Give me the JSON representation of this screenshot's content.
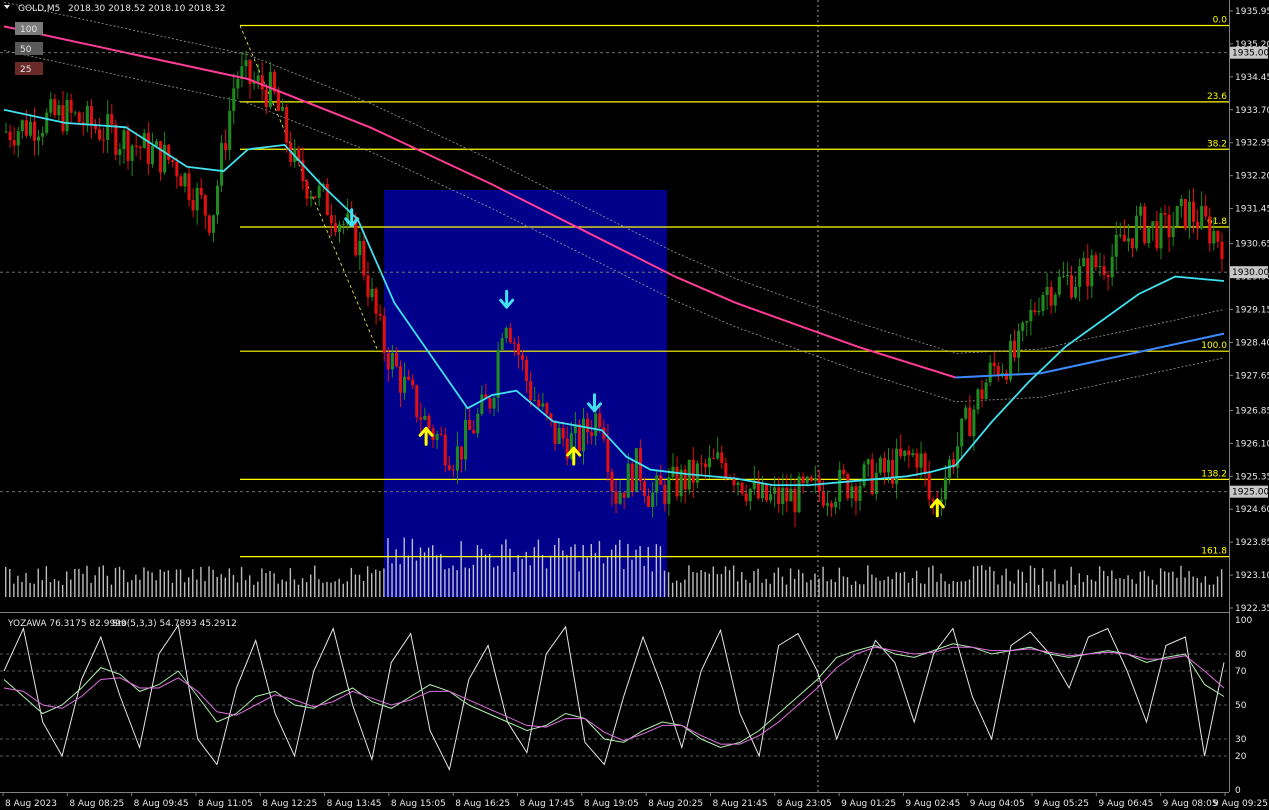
{
  "header": {
    "symbol": "GOLD,M5",
    "ohlc": "2018.30 2018.52 2018.10 2018.32",
    "collapse_icon": "triangle-down-icon"
  },
  "badges": [
    "100",
    "50",
    "25"
  ],
  "indicator": {
    "title": "YOZAWA 76.3175 82.9999",
    "stoch": "Sto(5,3,3) 54.7893 45.2912",
    "levels": [
      "100",
      "80",
      "70",
      "50",
      "30",
      "20",
      "0"
    ]
  },
  "colors": {
    "bull": "#1f8a1f",
    "bear": "#e01010",
    "fib": "#ffff00",
    "ma_fast": "#40e0f0",
    "ma_slow": "#ff3c96",
    "ma_blue": "#3c8cff",
    "zone": "#00008b",
    "volume": "#dddddd"
  },
  "chart_data": [
    {
      "type": "candlestick",
      "title": "GOLD,M5",
      "price_ticks": [
        "1935.95",
        "1935.20",
        "1934.45",
        "1933.70",
        "1932.95",
        "1932.20",
        "1931.45",
        "1930.65",
        "1929.90",
        "1929.15",
        "1928.40",
        "1927.65",
        "1926.85",
        "1926.10",
        "1925.35",
        "1924.60",
        "1923.85",
        "1923.10",
        "1922.35"
      ],
      "price_tags": [
        "1935.00",
        "1930.00",
        "1925.00"
      ],
      "ylim": [
        1922.35,
        1935.95
      ],
      "fib_levels": [
        {
          "label": "0.0",
          "price": 1935.62
        },
        {
          "label": "23.6",
          "price": 1933.88
        },
        {
          "label": "38.2",
          "price": 1932.8
        },
        {
          "label": "61.8",
          "price": 1931.03
        },
        {
          "label": "100.0",
          "price": 1928.2
        },
        {
          "label": "138.2",
          "price": 1925.28
        },
        {
          "label": "161.8",
          "price": 1923.52
        }
      ],
      "time_labels": [
        "8 Aug 2023",
        "8 Aug 08:25",
        "8 Aug 09:45",
        "8 Aug 11:05",
        "8 Aug 12:25",
        "8 Aug 13:45",
        "8 Aug 15:05",
        "8 Aug 16:25",
        "8 Aug 17:45",
        "8 Aug 19:05",
        "8 Aug 20:25",
        "8 Aug 21:45",
        "8 Aug 23:05",
        "9 Aug 01:25",
        "9 Aug 02:45",
        "9 Aug 04:05",
        "9 Aug 05:25",
        "9 Aug 06:45",
        "9 Aug 08:05",
        "9 Aug 09:25"
      ],
      "close_profile": [
        {
          "t": 0,
          "p": 1933.2
        },
        {
          "t": 0.05,
          "p": 1933.6
        },
        {
          "t": 0.1,
          "p": 1933.0
        },
        {
          "t": 0.14,
          "p": 1932.5
        },
        {
          "t": 0.17,
          "p": 1931.2
        },
        {
          "t": 0.19,
          "p": 1934.5
        },
        {
          "t": 0.22,
          "p": 1934.1
        },
        {
          "t": 0.24,
          "p": 1932.3
        },
        {
          "t": 0.27,
          "p": 1931.4
        },
        {
          "t": 0.29,
          "p": 1930.7
        },
        {
          "t": 0.31,
          "p": 1928.4
        },
        {
          "t": 0.33,
          "p": 1927.3
        },
        {
          "t": 0.35,
          "p": 1926.4
        },
        {
          "t": 0.37,
          "p": 1925.8
        },
        {
          "t": 0.4,
          "p": 1927.2
        },
        {
          "t": 0.41,
          "p": 1929.2
        },
        {
          "t": 0.43,
          "p": 1927.4
        },
        {
          "t": 0.45,
          "p": 1926.3
        },
        {
          "t": 0.47,
          "p": 1926.1
        },
        {
          "t": 0.49,
          "p": 1926.9
        },
        {
          "t": 0.5,
          "p": 1924.9
        },
        {
          "t": 0.52,
          "p": 1925.6
        },
        {
          "t": 0.53,
          "p": 1924.9
        },
        {
          "t": 0.56,
          "p": 1925.3
        },
        {
          "t": 0.59,
          "p": 1925.7
        },
        {
          "t": 0.62,
          "p": 1924.8
        },
        {
          "t": 0.65,
          "p": 1924.9
        },
        {
          "t": 0.68,
          "p": 1925.1
        },
        {
          "t": 0.72,
          "p": 1925.4
        },
        {
          "t": 0.75,
          "p": 1925.9
        },
        {
          "t": 0.76,
          "p": 1924.6
        },
        {
          "t": 0.77,
          "p": 1925.3
        },
        {
          "t": 0.79,
          "p": 1926.6
        },
        {
          "t": 0.81,
          "p": 1927.8
        },
        {
          "t": 0.83,
          "p": 1928.1
        },
        {
          "t": 0.85,
          "p": 1929.6
        },
        {
          "t": 0.88,
          "p": 1929.9
        },
        {
          "t": 0.91,
          "p": 1930.4
        },
        {
          "t": 0.93,
          "p": 1931.1
        },
        {
          "t": 0.95,
          "p": 1930.9
        },
        {
          "t": 0.97,
          "p": 1931.4
        },
        {
          "t": 1.0,
          "p": 1930.7
        }
      ],
      "ma_fast": [
        {
          "t": 0,
          "p": 1933.7
        },
        {
          "t": 0.05,
          "p": 1933.4
        },
        {
          "t": 0.1,
          "p": 1933.3
        },
        {
          "t": 0.15,
          "p": 1932.4
        },
        {
          "t": 0.18,
          "p": 1932.3
        },
        {
          "t": 0.2,
          "p": 1932.8
        },
        {
          "t": 0.23,
          "p": 1932.9
        },
        {
          "t": 0.26,
          "p": 1932.0
        },
        {
          "t": 0.29,
          "p": 1931.2
        },
        {
          "t": 0.32,
          "p": 1929.3
        },
        {
          "t": 0.35,
          "p": 1928.1
        },
        {
          "t": 0.38,
          "p": 1926.9
        },
        {
          "t": 0.4,
          "p": 1927.2
        },
        {
          "t": 0.42,
          "p": 1927.3
        },
        {
          "t": 0.45,
          "p": 1926.6
        },
        {
          "t": 0.47,
          "p": 1926.5
        },
        {
          "t": 0.49,
          "p": 1926.4
        },
        {
          "t": 0.51,
          "p": 1925.8
        },
        {
          "t": 0.53,
          "p": 1925.5
        },
        {
          "t": 0.56,
          "p": 1925.4
        },
        {
          "t": 0.6,
          "p": 1925.3
        },
        {
          "t": 0.63,
          "p": 1925.15
        },
        {
          "t": 0.66,
          "p": 1925.15
        },
        {
          "t": 0.7,
          "p": 1925.25
        },
        {
          "t": 0.74,
          "p": 1925.35
        },
        {
          "t": 0.76,
          "p": 1925.45
        },
        {
          "t": 0.78,
          "p": 1925.6
        },
        {
          "t": 0.81,
          "p": 1926.6
        },
        {
          "t": 0.84,
          "p": 1927.5
        },
        {
          "t": 0.87,
          "p": 1928.3
        },
        {
          "t": 0.9,
          "p": 1928.9
        },
        {
          "t": 0.93,
          "p": 1929.5
        },
        {
          "t": 0.96,
          "p": 1929.9
        },
        {
          "t": 1.0,
          "p": 1929.8
        }
      ],
      "ma_slow": [
        {
          "t": 0,
          "p": 1935.6
        },
        {
          "t": 0.1,
          "p": 1935.0
        },
        {
          "t": 0.2,
          "p": 1934.4
        },
        {
          "t": 0.3,
          "p": 1933.3
        },
        {
          "t": 0.4,
          "p": 1932.0
        },
        {
          "t": 0.5,
          "p": 1930.6
        },
        {
          "t": 0.55,
          "p": 1929.9
        },
        {
          "t": 0.6,
          "p": 1929.3
        },
        {
          "t": 0.65,
          "p": 1928.8
        },
        {
          "t": 0.7,
          "p": 1928.3
        },
        {
          "t": 0.74,
          "p": 1927.95
        },
        {
          "t": 0.78,
          "p": 1927.6
        }
      ],
      "ma_blue": [
        {
          "t": 0.78,
          "p": 1927.6
        },
        {
          "t": 0.85,
          "p": 1927.7
        },
        {
          "t": 0.9,
          "p": 1928.0
        },
        {
          "t": 0.95,
          "p": 1928.3
        },
        {
          "t": 1.0,
          "p": 1928.6
        }
      ],
      "signals": [
        {
          "t": 0.285,
          "dir": "down",
          "color": "#40e0f0"
        },
        {
          "t": 0.346,
          "dir": "up",
          "color": "#ffff00"
        },
        {
          "t": 0.412,
          "dir": "down",
          "color": "#40e0f0"
        },
        {
          "t": 0.467,
          "dir": "up",
          "color": "#ffff00"
        },
        {
          "t": 0.484,
          "dir": "down",
          "color": "#40e0f0"
        },
        {
          "t": 0.765,
          "dir": "up",
          "color": "#ffff00"
        }
      ]
    },
    {
      "type": "line",
      "title": "YOZAWA 76.3175 82.9999 Sto(5,3,3) 54.7893 45.2912",
      "ylim": [
        0,
        100
      ],
      "series": [
        {
          "name": "YOZAWA",
          "color": "#e6e6e6",
          "values": [
            70,
            95,
            40,
            20,
            65,
            90,
            55,
            25,
            80,
            97,
            30,
            15,
            60,
            88,
            45,
            20,
            70,
            95,
            50,
            18,
            75,
            92,
            35,
            12,
            65,
            85,
            40,
            22,
            80,
            96,
            28,
            15,
            55,
            90,
            60,
            25,
            70,
            94,
            45,
            20,
            85,
            92,
            70,
            30,
            60,
            88,
            75,
            40,
            80,
            95,
            55,
            30,
            85,
            93,
            80,
            60,
            90,
            95,
            70,
            40,
            85,
            90,
            20,
            75
          ]
        },
        {
          "name": "%K",
          "color": "#b0f0b0",
          "values": [
            65,
            55,
            45,
            50,
            60,
            72,
            68,
            58,
            62,
            70,
            55,
            40,
            45,
            55,
            58,
            50,
            48,
            55,
            60,
            52,
            48,
            55,
            62,
            58,
            50,
            45,
            40,
            35,
            38,
            45,
            42,
            30,
            28,
            35,
            40,
            38,
            30,
            25,
            28,
            35,
            45,
            55,
            65,
            78,
            82,
            85,
            80,
            78,
            82,
            86,
            84,
            80,
            82,
            84,
            80,
            78,
            80,
            82,
            80,
            75,
            78,
            80,
            62,
            55
          ]
        },
        {
          "name": "%D",
          "color": "#e070e0",
          "values": [
            60,
            58,
            50,
            48,
            55,
            65,
            66,
            60,
            60,
            66,
            58,
            46,
            44,
            50,
            56,
            53,
            49,
            52,
            58,
            54,
            50,
            53,
            58,
            58,
            53,
            48,
            43,
            38,
            37,
            42,
            42,
            34,
            29,
            33,
            38,
            38,
            32,
            27,
            27,
            32,
            40,
            50,
            60,
            72,
            80,
            84,
            82,
            80,
            81,
            84,
            84,
            82,
            82,
            83,
            81,
            79,
            80,
            81,
            80,
            77,
            77,
            79,
            70,
            60
          ]
        }
      ]
    }
  ]
}
